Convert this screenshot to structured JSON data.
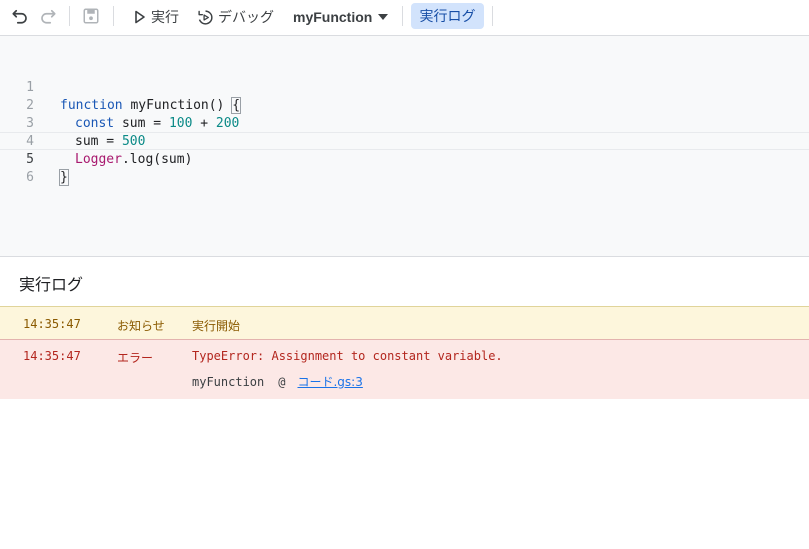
{
  "toolbar": {
    "undo_icon": "undo-icon",
    "redo_icon": "redo-icon",
    "save_icon": "save-icon",
    "run_label": "実行",
    "debug_label": "デバッグ",
    "function_select": "myFunction",
    "log_toggle_label": "実行ログ"
  },
  "editor": {
    "line_numbers": [
      "1",
      "2",
      "3",
      "4",
      "5",
      "6"
    ],
    "lines": {
      "l1_kw": "function",
      "l1_rest": " myFunction() ",
      "l1_brace": "{",
      "l2_kw": "const",
      "l2_mid": " sum = ",
      "l2_n1": "100",
      "l2_op": " + ",
      "l2_n2": "200",
      "l3_pre": "sum = ",
      "l3_num": "500",
      "l4_cls": "Logger",
      "l4_rest": ".log(sum)",
      "l5_brace": "}"
    },
    "current_line": 5
  },
  "log": {
    "title": "実行ログ",
    "entries": [
      {
        "time": "14:35:47",
        "level": "お知らせ",
        "message": "実行開始"
      },
      {
        "time": "14:35:47",
        "level": "エラー",
        "message": "TypeError: Assignment to constant variable.",
        "stack_function": "myFunction",
        "stack_at": "@",
        "stack_link": "コード.gs:3"
      }
    ]
  },
  "colors": {
    "keyword": "#1a57b5",
    "number": "#0b8a87",
    "class": "#a8196e",
    "info_bg": "#fdf6dc",
    "error_bg": "#fce8e6",
    "toggle_bg": "#d2e3fc"
  }
}
